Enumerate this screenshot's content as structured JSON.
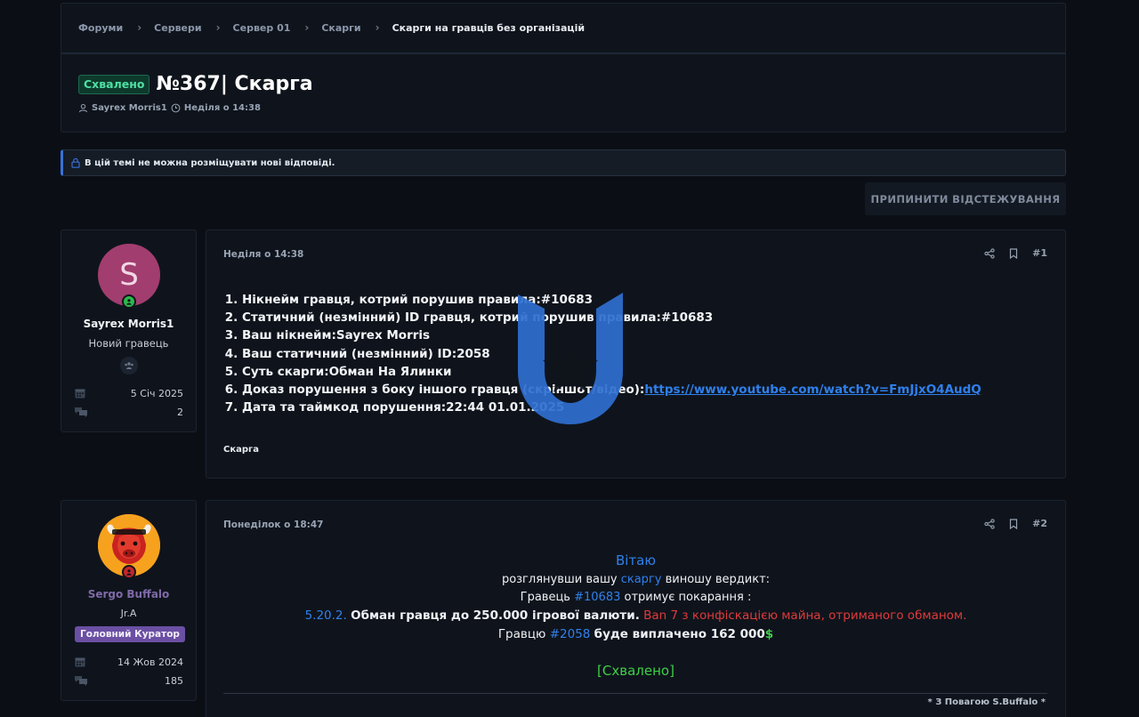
{
  "breadcrumb": [
    "Форуми",
    "Сервери",
    "Сервер 01",
    "Скарги",
    "Скарги на гравців без організацій"
  ],
  "thread": {
    "badge": "Схвалено",
    "title": "№367| Скарга",
    "author": "Sayrex Morris1",
    "date": "Неділя о 14:38"
  },
  "notice": {
    "text": "В цій темі не можна розміщувати нові відповіді."
  },
  "unwatch_button": "ПРИПИНИТИ ВІДСТЕЖУВАННЯ",
  "posts": [
    {
      "user": {
        "avatar_letter": "S",
        "name": "Sayrex Morris1",
        "title": "Новий гравець",
        "joined": "5 Січ 2025",
        "messages": "2"
      },
      "date": "Неділя о 14:38",
      "number": "#1",
      "items": [
        "Нікнейм гравця, котрий порушив правила:#10683",
        "Статичний (незмінний) ID гравця, котрий порушив правила:#10683",
        "Ваш нікнейм:Sayrex Morris",
        "Ваш статичний (незмінний) ID:2058",
        "Суть скарги:Обман На Ялинки",
        "Доказ порушення з боку іншого гравця (скріншот/відео):",
        "Дата та таймкод порушення:22:44 01.01.2025"
      ],
      "link": "https://www.youtube.com/watch?v=FmJjxO4AudQ",
      "signature": "Скарга"
    },
    {
      "user": {
        "name": "Sergo Buffalo",
        "title": "Jr.A",
        "role": "Головний Куратор",
        "joined": "14 Жов 2024",
        "messages": "185"
      },
      "date": "Понеділок о 18:47",
      "number": "#2",
      "greeting": "Вітаю",
      "line1_a": "розглянувши вашу",
      "line1_b": "скаргу",
      "line1_c": "виношу вердикт:",
      "line2_a": "Гравець",
      "line2_b": "#10683",
      "line2_c": "отримує покарання :",
      "line3_a": "5.20.2.",
      "line3_b": "Обман гравця до 250.000 ігрової валюти.",
      "line3_c": "Ban 7 з конфіскацією майна, отриманого обманом.",
      "line4_a": "Гравцю",
      "line4_b": "#2058",
      "line4_c": "буде виплачено 162 000",
      "line4_d": "$",
      "status": "[Схвалено]",
      "signature": "* З Повагою S.Buffalo *"
    }
  ],
  "colors": {
    "background": "#0b0f15",
    "card": "#0f141c",
    "accent_blue": "#2f80ed",
    "approved_green": "#4ee0a4",
    "verdict_red": "#e03a3a",
    "role_badge": "#6a4fa3"
  },
  "icons": [
    "user-icon",
    "clock-icon",
    "lock-icon",
    "calendar-icon",
    "messages-icon",
    "share-icon",
    "bookmark-icon",
    "group-icon"
  ]
}
